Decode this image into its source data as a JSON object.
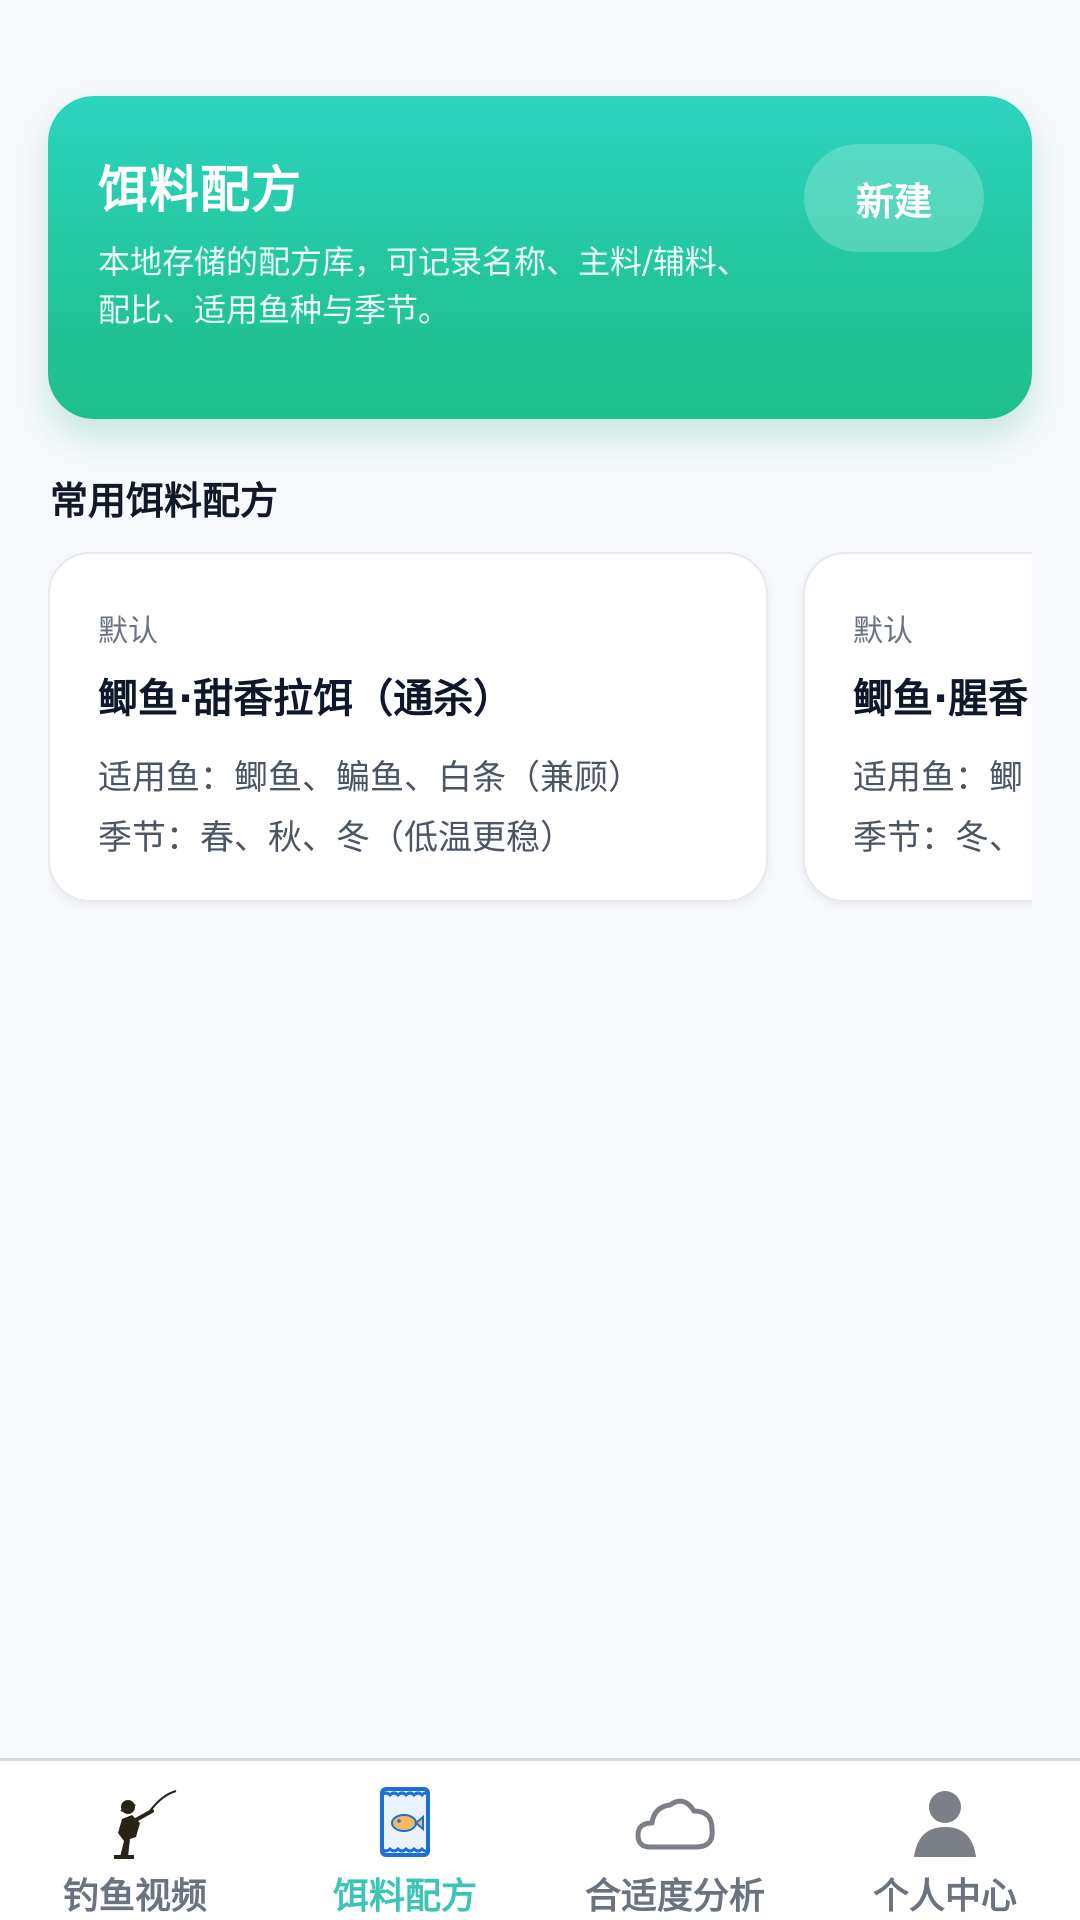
{
  "header": {
    "title": "饵料配方",
    "description": "本地存储的配方库，可记录名称、主料/辅料、配比、适用鱼种与季节。",
    "new_button": "新建"
  },
  "section": {
    "title": "常用饵料配方"
  },
  "recipes": [
    {
      "tag": "默认",
      "name": "鲫鱼·甜香拉饵（通杀）",
      "fish": "适用鱼：鲫鱼、鳊鱼、白条（兼顾）",
      "season": "季节：春、秋、冬（低温更稳）"
    },
    {
      "tag": "默认",
      "name": "鲫鱼·腥香",
      "fish": "适用鱼：鲫",
      "season": "季节：冬、"
    }
  ],
  "tabbar": {
    "items": [
      {
        "label": "钓鱼视频",
        "icon": "fisherman-icon"
      },
      {
        "label": "饵料配方",
        "icon": "bait-bag-icon",
        "active": true
      },
      {
        "label": "合适度分析",
        "icon": "cloud-icon"
      },
      {
        "label": "个人中心",
        "icon": "person-icon"
      }
    ],
    "active_color": "#3cc4b5"
  }
}
